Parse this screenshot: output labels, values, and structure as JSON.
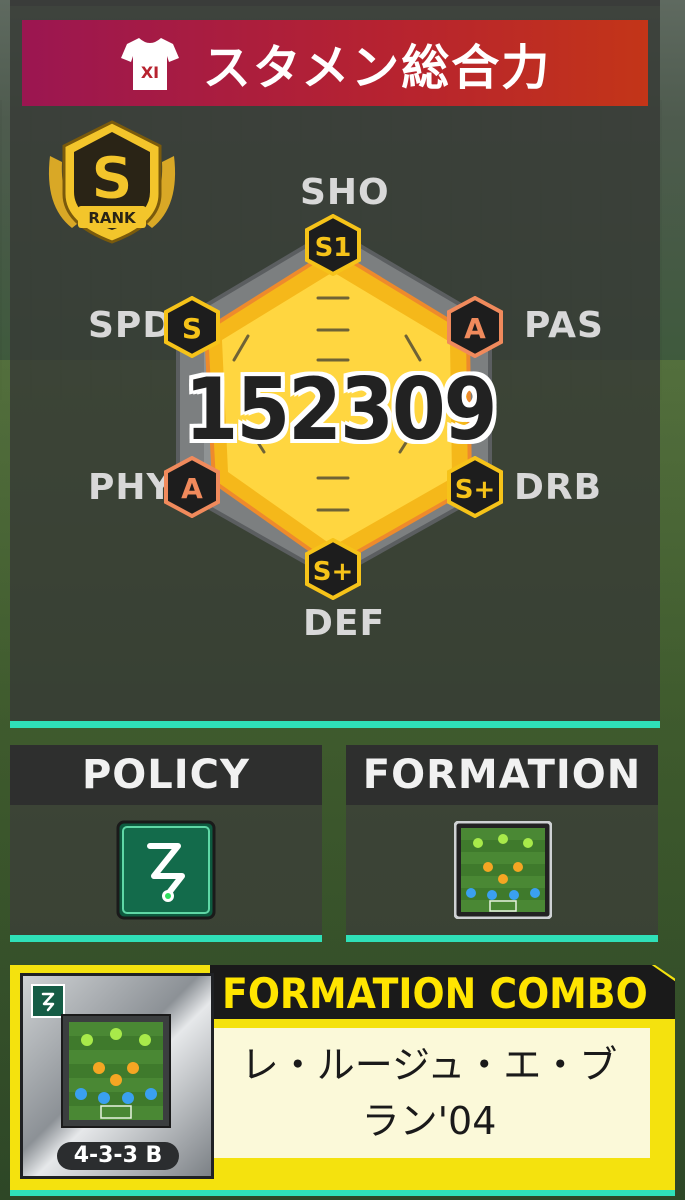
{
  "header": {
    "title": "スタメン総合力",
    "shirt_label": "XI"
  },
  "rank": {
    "grade": "S",
    "label": "RANK"
  },
  "stats": [
    {
      "key": "sho",
      "label": "SHO",
      "grade": "S1",
      "color": "#f6c319"
    },
    {
      "key": "pas",
      "label": "PAS",
      "grade": "A",
      "color": "#f08a5c"
    },
    {
      "key": "drb",
      "label": "DRB",
      "grade": "S+",
      "color": "#f6c319"
    },
    {
      "key": "def",
      "label": "DEF",
      "grade": "S+",
      "color": "#f6c319"
    },
    {
      "key": "phy",
      "label": "PHY",
      "grade": "A",
      "color": "#f08a5c"
    },
    {
      "key": "spd",
      "label": "SPD",
      "grade": "S",
      "color": "#f6c319"
    }
  ],
  "total_power": "152309",
  "policy": {
    "title": "POLICY",
    "icon": "policy-route-icon"
  },
  "formation": {
    "title": "FORMATION",
    "icon": "formation-pitch-icon"
  },
  "combo": {
    "title": "FORMATION COMBO",
    "name": "レ・ルージュ・エ・ブラン'04",
    "formation_label": "4-3-3 B"
  },
  "colors": {
    "accent_line": "#2fe0b8",
    "combo_yellow": "#f4e20e",
    "title_red": "#b7232f"
  }
}
